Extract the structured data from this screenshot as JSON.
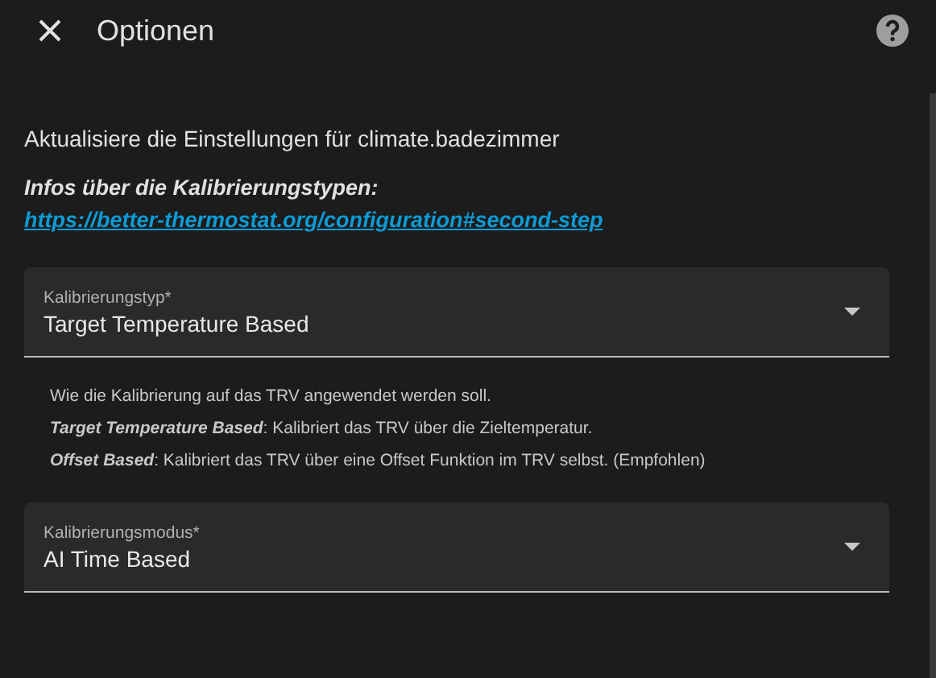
{
  "dialog": {
    "title": "Optionen"
  },
  "intro": "Aktualisiere die Einstellungen für climate.badezimmer",
  "info": {
    "label": "Infos über die Kalibrierungstypen:",
    "link": "https://better-thermostat.org/configuration#second-step"
  },
  "fields": [
    {
      "label": "Kalibrierungstyp*",
      "value": "Target Temperature Based",
      "help": [
        "Wie die Kalibrierung auf das TRV angewendet werden soll.",
        "*Target Temperature Based*: Kalibriert das TRV über die Zieltemperatur.",
        "*Offset Based*: Kalibriert das TRV über eine Offset Funktion im TRV selbst. (Empfohlen)"
      ]
    },
    {
      "label": "Kalibrierungsmodus*",
      "value": "AI Time Based"
    }
  ]
}
